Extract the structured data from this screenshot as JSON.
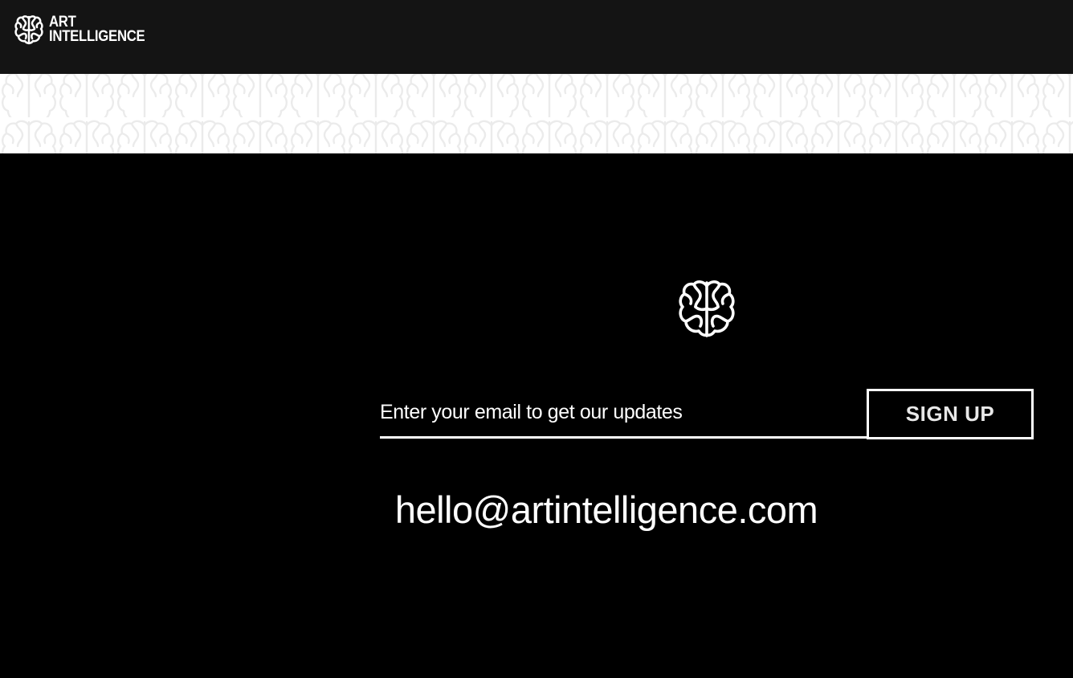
{
  "header": {
    "logo": {
      "icon": "brain-icon",
      "line1": "ART",
      "line2": "INTELLIGENCE"
    },
    "background_color": "#141414"
  },
  "pattern_band": {
    "motif": "brain-icon",
    "background_color": "#ffffff",
    "motif_color": "#ececec"
  },
  "footer": {
    "icon": "brain-icon",
    "signup": {
      "placeholder": "Enter your email to get our updates",
      "value": "",
      "button_label": "SIGN UP"
    },
    "contact_email": "hello@artintelligence.com",
    "background_color": "#000000",
    "text_color": "#ffffff"
  }
}
